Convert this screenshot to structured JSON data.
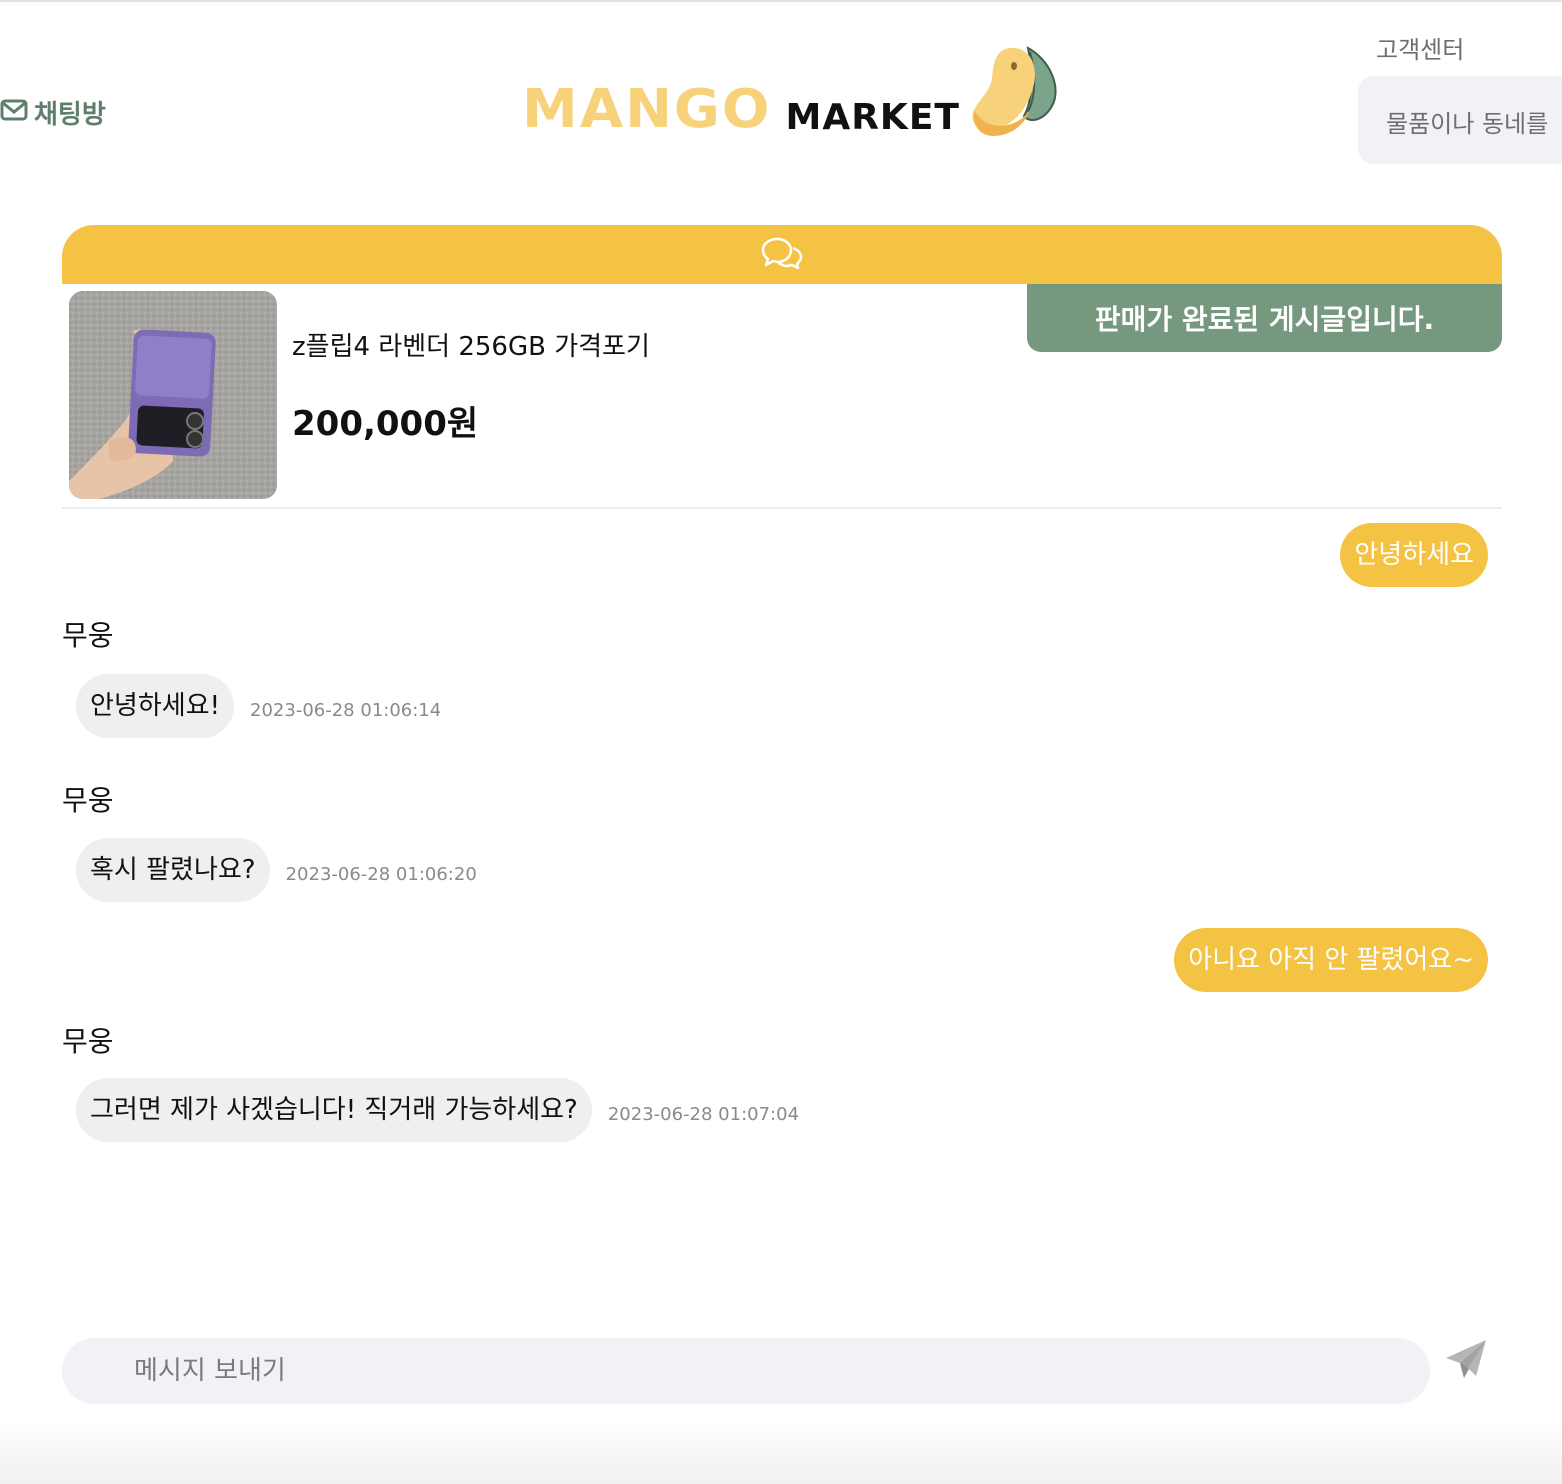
{
  "header": {
    "chat_link_label": "채팅방",
    "logo_word1": "MANGO",
    "logo_word2": "MARKET",
    "support_label": "고객센터",
    "search_placeholder": "물품이나 동네를"
  },
  "product": {
    "title": "z플립4 라벤더 256GB 가격포기",
    "price": "200,000원",
    "status_banner": "판매가 완료된 게시글입니다."
  },
  "messages": [
    {
      "direction": "out",
      "text": "안녕하세요"
    },
    {
      "direction": "in",
      "sender": "무웅",
      "text": "안녕하세요!",
      "time": "2023-06-28 01:06:14"
    },
    {
      "direction": "in",
      "sender": "무웅",
      "text": "혹시 팔렸나요?",
      "time": "2023-06-28 01:06:20"
    },
    {
      "direction": "out",
      "text": "아니요 아직 안 팔렸어요~"
    },
    {
      "direction": "in",
      "sender": "무웅",
      "text": "그러면 제가 사겠습니다! 직거래 가능하세요?",
      "time": "2023-06-28 01:07:04"
    }
  ],
  "composer": {
    "placeholder": "메시지 보내기"
  },
  "icons": {
    "chat_link": "envelope-icon",
    "chat_header": "chat-bubbles-icon",
    "send": "paper-plane-icon"
  },
  "colors": {
    "accent": "#f5c344",
    "logo_yellow": "#f7d27a",
    "green": "#75987e",
    "incoming_bubble": "#efefef",
    "input_bg": "#f1f2f5"
  }
}
